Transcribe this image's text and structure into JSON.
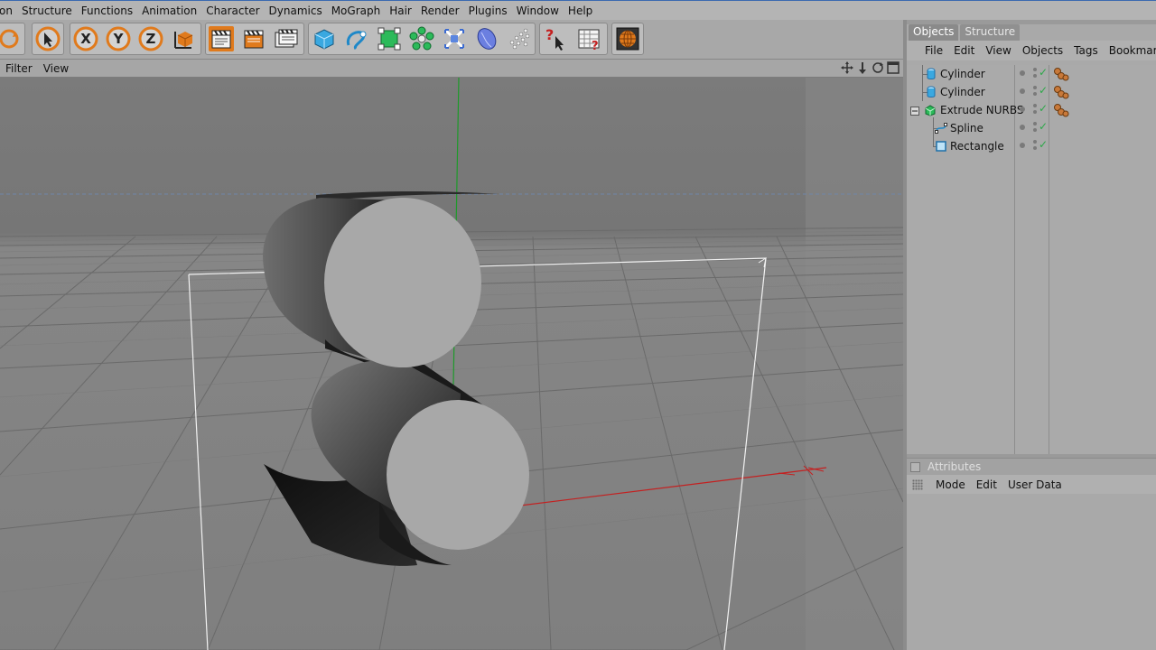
{
  "menubar": {
    "items": [
      "on",
      "Structure",
      "Functions",
      "Animation",
      "Character",
      "Dynamics",
      "MoGraph",
      "Hair",
      "Render",
      "Plugins",
      "Window",
      "Help"
    ]
  },
  "toolbar": {
    "buttons": [
      {
        "name": "undo-redo-icon"
      },
      {
        "name": "live-selection-icon"
      },
      {
        "name": "x-axis-lock-icon",
        "label": "X"
      },
      {
        "name": "y-axis-lock-icon",
        "label": "Y"
      },
      {
        "name": "z-axis-lock-icon",
        "label": "Z"
      },
      {
        "name": "coordinate-system-icon"
      },
      {
        "name": "render-view-icon"
      },
      {
        "name": "render-picture-viewer-icon"
      },
      {
        "name": "render-settings-icon"
      },
      {
        "name": "add-cube-icon"
      },
      {
        "name": "add-spline-icon"
      },
      {
        "name": "add-nurbs-icon"
      },
      {
        "name": "add-array-icon"
      },
      {
        "name": "add-deformer-icon"
      },
      {
        "name": "add-scene-icon"
      },
      {
        "name": "add-particles-icon"
      },
      {
        "name": "help-pointer-icon"
      },
      {
        "name": "timeline-help-icon"
      },
      {
        "name": "content-browser-icon"
      }
    ]
  },
  "viewport": {
    "menus": [
      "Filter",
      "View"
    ],
    "nav_icons": [
      "move-view-icon",
      "zoom-view-icon",
      "rotate-view-icon",
      "maximize-view-icon"
    ]
  },
  "objects_panel": {
    "tabs": [
      "Objects",
      "Structure"
    ],
    "active_tab": "Objects",
    "menus": [
      "File",
      "Edit",
      "View",
      "Objects",
      "Tags",
      "Bookmarks"
    ],
    "objects": [
      {
        "name": "Cylinder",
        "icon": "cylinder-icon",
        "depth": 0,
        "has_tag": true
      },
      {
        "name": "Cylinder",
        "icon": "cylinder-icon",
        "depth": 0,
        "has_tag": true
      },
      {
        "name": "Extrude NURBS",
        "icon": "extrude-nurbs-icon",
        "depth": 0,
        "has_tag": true,
        "expanded": true
      },
      {
        "name": "Spline",
        "icon": "spline-icon",
        "depth": 1,
        "has_tag": false
      },
      {
        "name": "Rectangle",
        "icon": "rectangle-icon",
        "depth": 1,
        "has_tag": false
      }
    ]
  },
  "attributes_panel": {
    "title": "Attributes",
    "menus": [
      "Mode",
      "Edit",
      "User Data"
    ]
  },
  "colors": {
    "viewport_bg": "#7d7d7d",
    "x_axis": "#c42020",
    "y_axis": "#1e9a2a",
    "check_green": "#2ea84a",
    "active_icon_orange": "#e07a1c"
  }
}
